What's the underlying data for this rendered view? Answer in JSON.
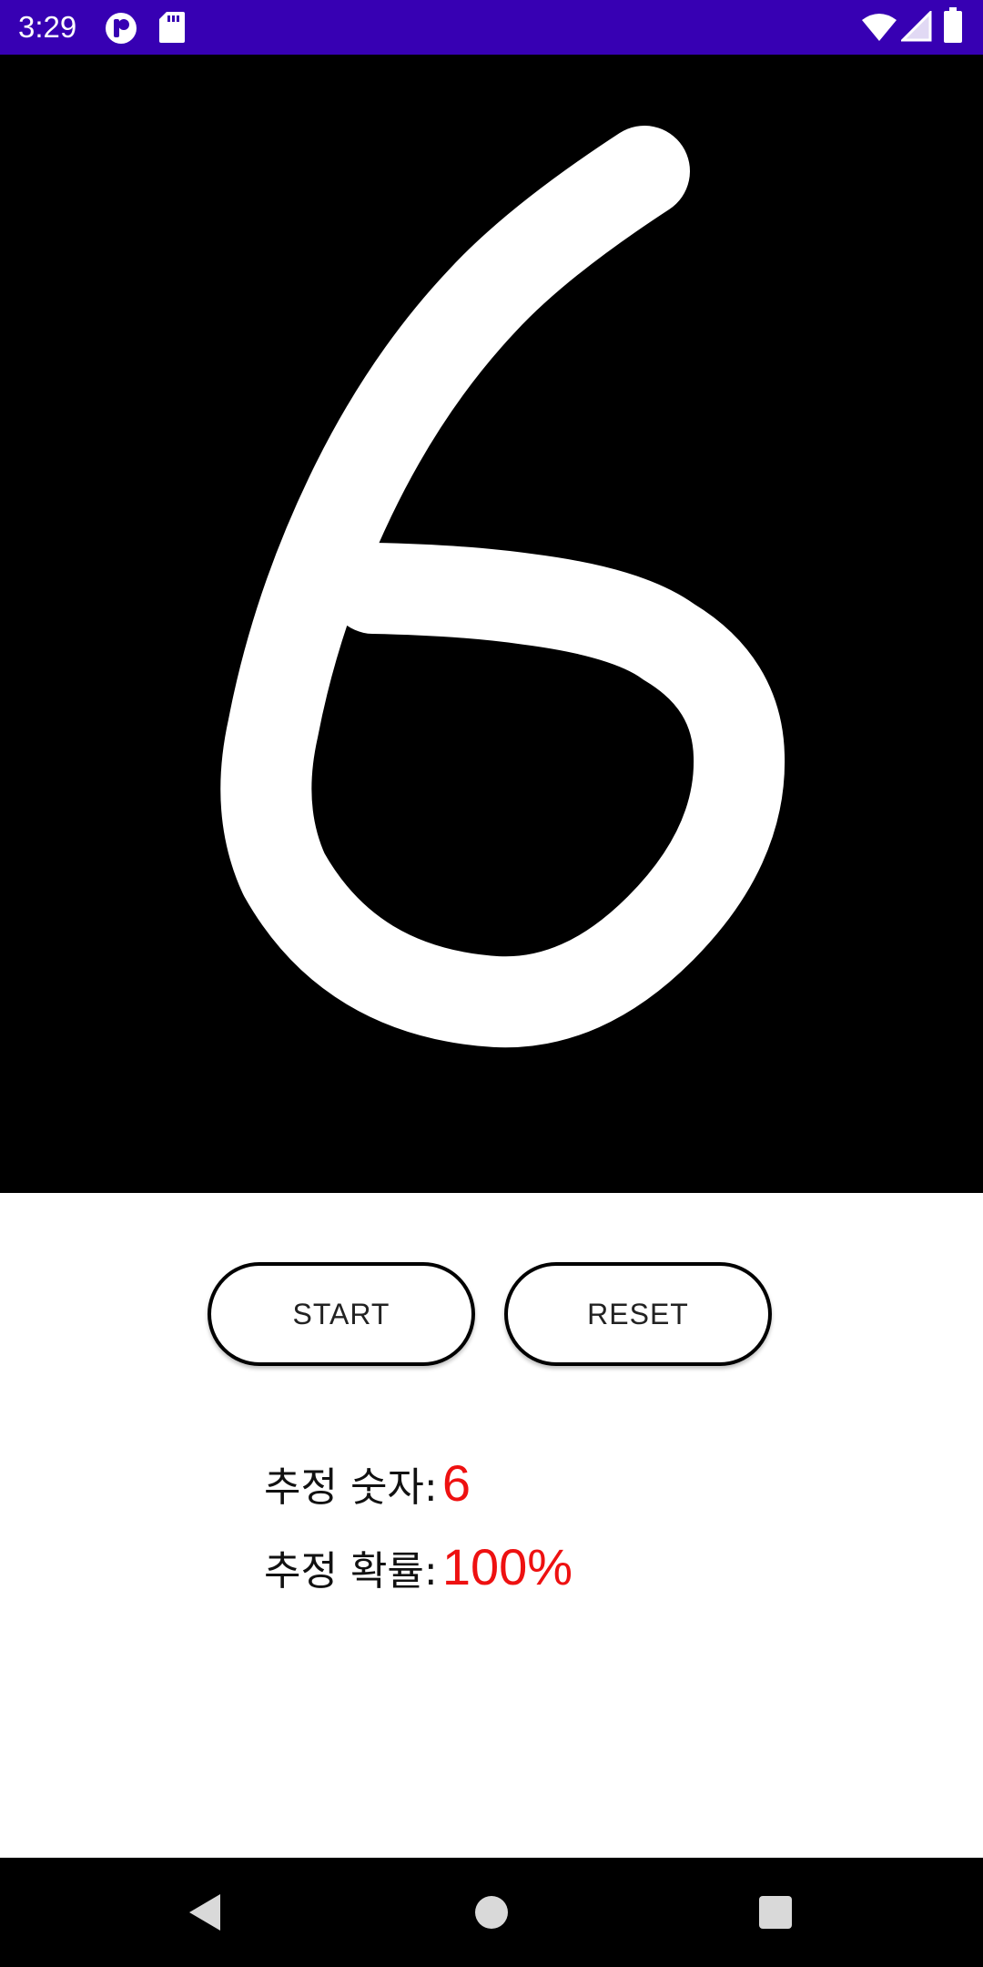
{
  "status_bar": {
    "time": "3:29",
    "background": "#3700b3",
    "left_icons": [
      "app-notification-icon",
      "sd-card-icon"
    ],
    "right_icons": [
      "wifi-icon",
      "cellular-signal-icon",
      "battery-icon"
    ]
  },
  "canvas": {
    "background": "#000000",
    "stroke_color": "#ffffff",
    "drawn_digit": "6"
  },
  "buttons": {
    "start_label": "START",
    "reset_label": "RESET"
  },
  "results": {
    "digit_label": "추정 숫자:",
    "digit_value": "6",
    "prob_label": "추정 확률:",
    "prob_value": "100%",
    "value_color": "#ee1111"
  },
  "nav_bar": {
    "items": [
      "back-icon",
      "home-icon",
      "recents-icon"
    ]
  }
}
